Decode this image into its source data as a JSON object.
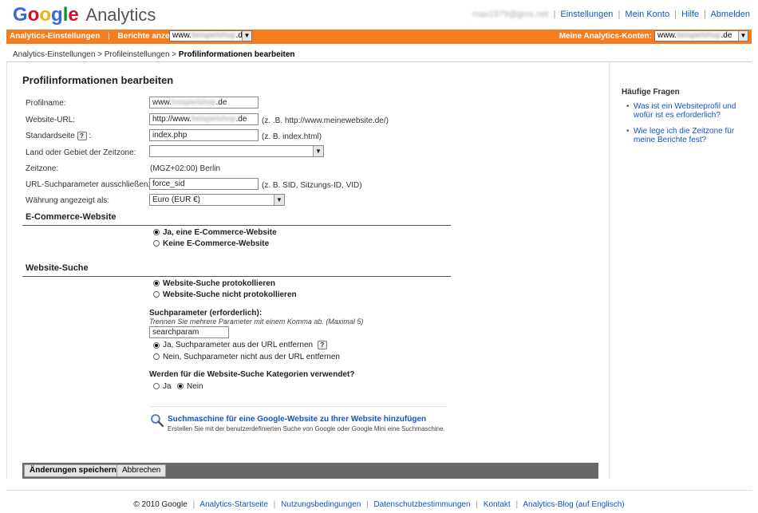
{
  "header": {
    "logo_letters": [
      {
        "ch": "G",
        "color": "#3369e8"
      },
      {
        "ch": "o",
        "color": "#d50f25"
      },
      {
        "ch": "o",
        "color": "#eeb211"
      },
      {
        "ch": "g",
        "color": "#3369e8"
      },
      {
        "ch": "l",
        "color": "#009925"
      },
      {
        "ch": "e",
        "color": "#d50f25"
      }
    ],
    "product": "Analytics",
    "email": "max1979@gmx.net",
    "links": [
      "Einstellungen",
      "Mein Konto",
      "Hilfe",
      "Abmelden"
    ]
  },
  "nav": {
    "settings": "Analytics-Einstellungen",
    "reports_label": "Berichte anzeigen:",
    "reports_value_prefix": "www.",
    "reports_value_blur": "beispielshop",
    "reports_value_suffix": ".de",
    "accounts_label": "Meine Analytics-Konten:",
    "accounts_value_prefix": "www.",
    "accounts_value_blur": "beispielshop",
    "accounts_value_suffix": ".de",
    "bar_color": "#f47d20"
  },
  "breadcrumb": {
    "item1": "Analytics-Einstellungen",
    "item2": "Profileinstellungen",
    "current": "Profilinformationen bearbeiten",
    "sep": ">"
  },
  "form": {
    "title": "Profilinformationen bearbeiten",
    "profile_name": {
      "label": "Profilname:",
      "prefix": "www.",
      "blur": "beispielshop",
      "suffix": ".de"
    },
    "website_url": {
      "label": "Website-URL:",
      "prefix": "http://www.",
      "blur": "beispielshop",
      "suffix": ".de",
      "hint": "(z. .B. http://www.meinewebsite.de/)"
    },
    "default_page": {
      "label": "Standardseite",
      "help": "?",
      "colon": ":",
      "value": "index.php",
      "hint": "(z. B. index.html)"
    },
    "timezone_country": {
      "label": "Land oder Gebiet der Zeitzone:",
      "value": ""
    },
    "timezone": {
      "label": "Zeitzone:",
      "value": "(MGZ+02:00) Berlin"
    },
    "exclude_params": {
      "label": "URL-Suchparameter ausschließen:",
      "value": "force_sid",
      "hint": "(z. B. SID, Sitzungs-ID, VID)"
    },
    "currency": {
      "label": "Währung angezeigt als:",
      "value": "Euro (EUR €)"
    }
  },
  "ecommerce": {
    "title": "E-Commerce-Website",
    "options": [
      {
        "label": "Ja, eine E-Commerce-Website",
        "checked": true
      },
      {
        "label": "Keine E-Commerce-Website",
        "checked": false
      }
    ]
  },
  "site_search": {
    "title": "Website-Suche",
    "options": [
      {
        "label": "Website-Suche protokollieren",
        "checked": true
      },
      {
        "label": "Website-Suche nicht protokollieren",
        "checked": false
      }
    ],
    "param_label": "Suchparameter (erforderlich):",
    "param_hint": "Trennen Sie mehrere Parameter mit einem Komma ab. (Maximal 5)",
    "param_value": "searchparam",
    "strip_options": [
      {
        "label": "Ja, Suchparameter aus der URL entfernen",
        "checked": true
      },
      {
        "label": "Nein, Suchparameter nicht aus der URL entfernen",
        "checked": false
      }
    ],
    "category_question": "Werden für die Website-Suche Kategorien verwendet?",
    "category_options": [
      {
        "label": "Ja",
        "checked": false
      },
      {
        "label": "Nein",
        "checked": true
      }
    ],
    "promo_link": "Suchmaschine für eine Google-Website zu Ihrer Website hinzufügen",
    "promo_desc": "Erstellen Sie mit der benutzerdefinierten Suche von Google oder Google Mini eine Suchmaschine."
  },
  "buttons": {
    "save": "Änderungen speichern",
    "cancel": "Abbrechen"
  },
  "sidebar": {
    "title": "Häufige Fragen",
    "items": [
      "Was ist ein Websiteprofil und wofür ist es erforderlich?",
      "Wie lege ich die Zeitzone für meine Berichte fest?"
    ]
  },
  "footer": {
    "copyright": "© 2010 Google",
    "links": [
      "Analytics-Startseite",
      "Nutzungsbedingungen",
      "Datenschutzbestimmungen",
      "Kontakt",
      "Analytics-Blog (auf Englisch)"
    ]
  }
}
